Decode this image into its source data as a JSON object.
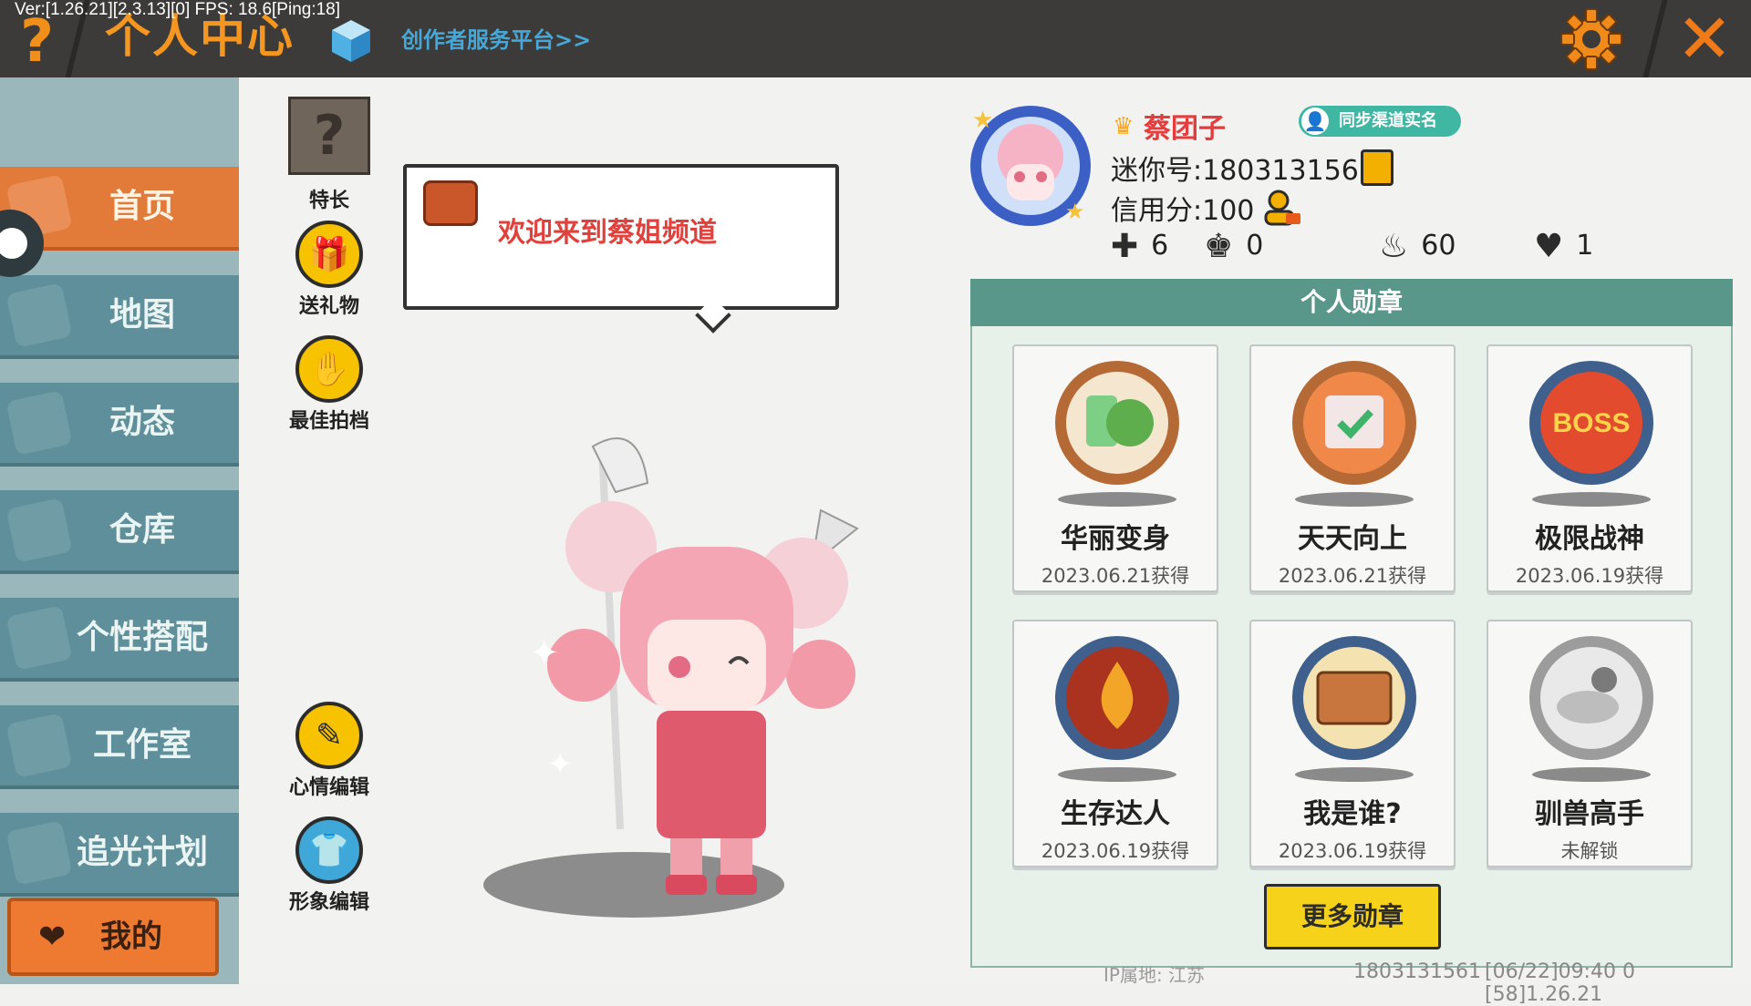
{
  "version_text": "Ver:[1.26.21][2.3.13][0] FPS: 18.6[Ping:18]",
  "header": {
    "help_icon": "?",
    "title": "个人中心",
    "creator_link": "创作者服务平台>>",
    "close_icon": "✕"
  },
  "nav": {
    "items": [
      {
        "label": "首页",
        "active": true
      },
      {
        "label": "地图"
      },
      {
        "label": "动态"
      },
      {
        "label": "仓库"
      },
      {
        "label": "个性搭配"
      },
      {
        "label": "工作室"
      },
      {
        "label": "追光计划"
      }
    ],
    "mine_label": "我的"
  },
  "side_buttons": {
    "talent": "特长",
    "gift": "送礼物",
    "best_partner": "最佳拍档",
    "mood_edit": "心情编辑",
    "avatar_edit": "形象编辑"
  },
  "bubble": {
    "message": "欢迎来到蔡姐频道"
  },
  "profile": {
    "nickname": "蔡团子",
    "sync_label": "同步渠道实名",
    "mini_id": "迷你号:1803131561",
    "credit": "信用分:100",
    "stats": [
      {
        "icon": "plus-icon",
        "value": "6"
      },
      {
        "icon": "fans-icon",
        "value": "0"
      },
      {
        "icon": "flame-icon",
        "value": "60"
      },
      {
        "icon": "heart-icon",
        "value": "1"
      }
    ]
  },
  "medals": {
    "title": "个人勋章",
    "items": [
      {
        "name": "华丽变身",
        "date": "2023.06.21获得"
      },
      {
        "name": "天天向上",
        "date": "2023.06.21获得"
      },
      {
        "name": "极限战神",
        "date": "2023.06.19获得"
      },
      {
        "name": "生存达人",
        "date": "2023.06.19获得"
      },
      {
        "name": "我是谁?",
        "date": "2023.06.19获得"
      },
      {
        "name": "驯兽高手",
        "date": "未解锁"
      }
    ],
    "more_label": "更多勋章",
    "boss_text": "BOSS"
  },
  "footer": {
    "ip": "IP属地: 江苏",
    "uid": "1803131561",
    "timestamp": "[06/22]09:40 0  [58]1.26.21"
  },
  "colors": {
    "accent_orange": "#f59620",
    "nav_teal": "#5e8f9a",
    "medal_header": "#5a978b",
    "button_yellow": "#f7d21a"
  }
}
